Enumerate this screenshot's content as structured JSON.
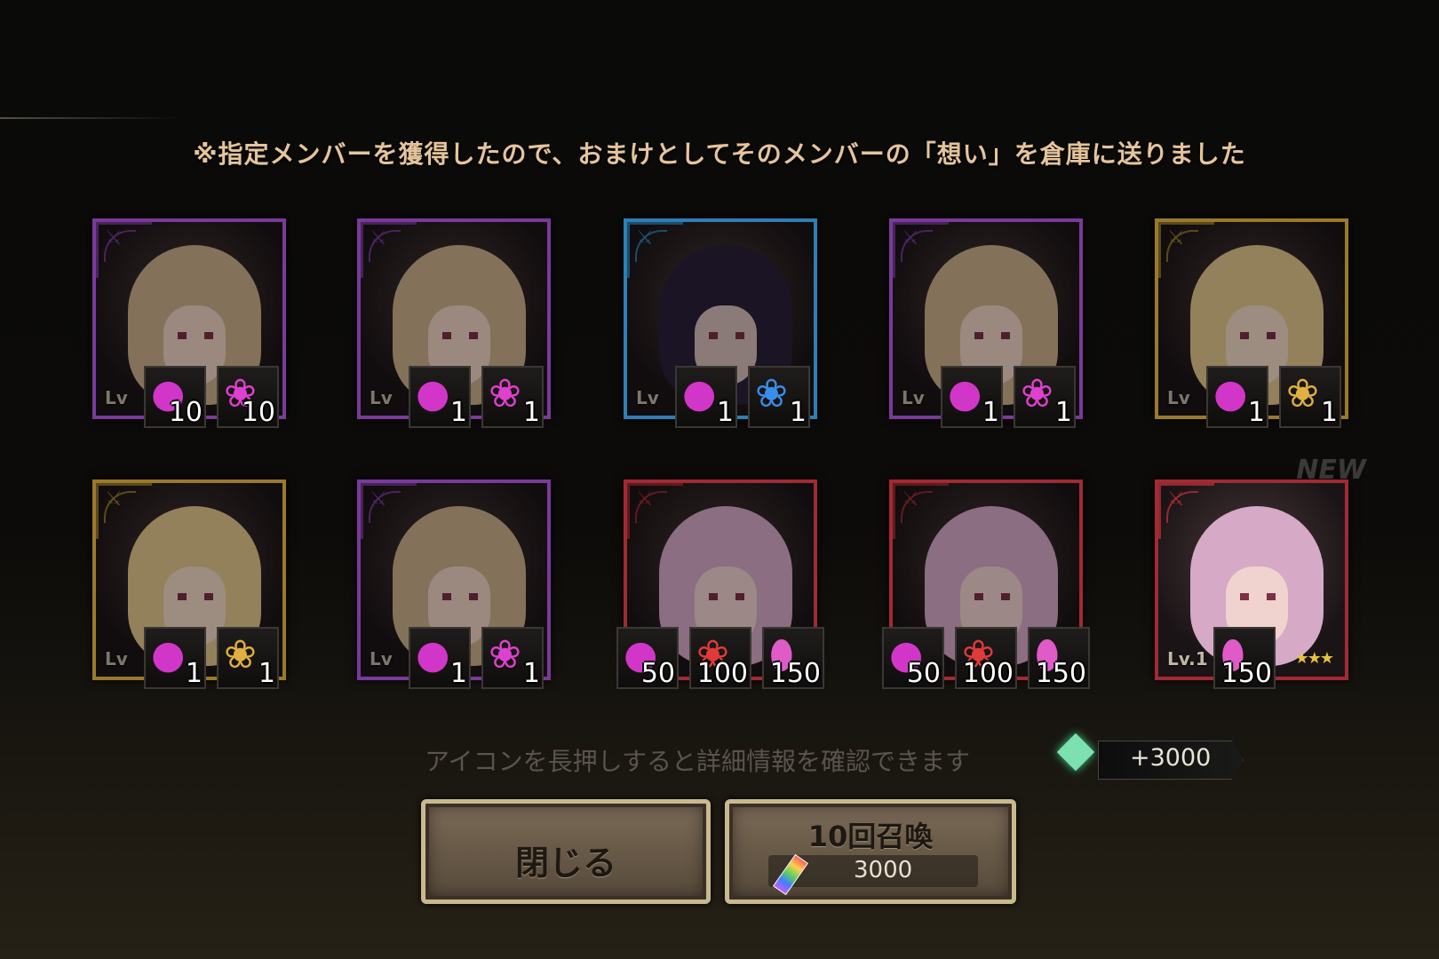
{
  "notice": "※指定メンバーを獲得したので、おまけとしてそのメンバーの「想い」を倉庫に送りました",
  "hint": "アイコンを長押しすると詳細情報を確認できます",
  "reward": {
    "icon": "green-gem-icon",
    "value": "+3000"
  },
  "buttons": {
    "close_label": "閉じる",
    "summon_label": "10回召喚",
    "summon_cost": "3000",
    "summon_cost_icon": "rainbow-crystal-icon"
  },
  "cards": [
    {
      "frame": "purple",
      "level": "Lv",
      "items": [
        {
          "icon": "apple-icon",
          "qty": "10"
        },
        {
          "icon": "pink-spirit-icon",
          "qty": "10"
        }
      ]
    },
    {
      "frame": "purple",
      "level": "Lv",
      "items": [
        {
          "icon": "apple-icon",
          "qty": "1"
        },
        {
          "icon": "pink-spirit-icon",
          "qty": "1"
        }
      ]
    },
    {
      "frame": "blue",
      "level": "Lv",
      "items": [
        {
          "icon": "apple-icon",
          "qty": "1"
        },
        {
          "icon": "blue-spirit-icon",
          "qty": "1"
        }
      ]
    },
    {
      "frame": "purple",
      "level": "Lv",
      "items": [
        {
          "icon": "apple-icon",
          "qty": "1"
        },
        {
          "icon": "pink-spirit-icon",
          "qty": "1"
        }
      ]
    },
    {
      "frame": "gold",
      "level": "Lv",
      "items": [
        {
          "icon": "apple-icon",
          "qty": "1"
        },
        {
          "icon": "gold-spirit-icon",
          "qty": "1"
        }
      ]
    },
    {
      "frame": "gold",
      "level": "Lv",
      "items": [
        {
          "icon": "apple-icon",
          "qty": "1"
        },
        {
          "icon": "gold-spirit-icon",
          "qty": "1"
        }
      ]
    },
    {
      "frame": "purple",
      "level": "Lv",
      "items": [
        {
          "icon": "apple-icon",
          "qty": "1"
        },
        {
          "icon": "pink-spirit-icon",
          "qty": "1"
        }
      ]
    },
    {
      "frame": "red",
      "level": "",
      "items": [
        {
          "icon": "apple-icon",
          "qty": "50"
        },
        {
          "icon": "red-spirit-icon",
          "qty": "100"
        },
        {
          "icon": "pink-egg-icon",
          "qty": "150"
        }
      ]
    },
    {
      "frame": "red",
      "level": "",
      "items": [
        {
          "icon": "apple-icon",
          "qty": "50"
        },
        {
          "icon": "red-spirit-icon",
          "qty": "100"
        },
        {
          "icon": "pink-egg-icon",
          "qty": "150"
        }
      ]
    },
    {
      "frame": "red",
      "level": "Lv.1",
      "new": "NEW",
      "stars": "★★★",
      "items": [
        {
          "icon": "pink-egg-icon",
          "qty": "150"
        }
      ]
    }
  ]
}
